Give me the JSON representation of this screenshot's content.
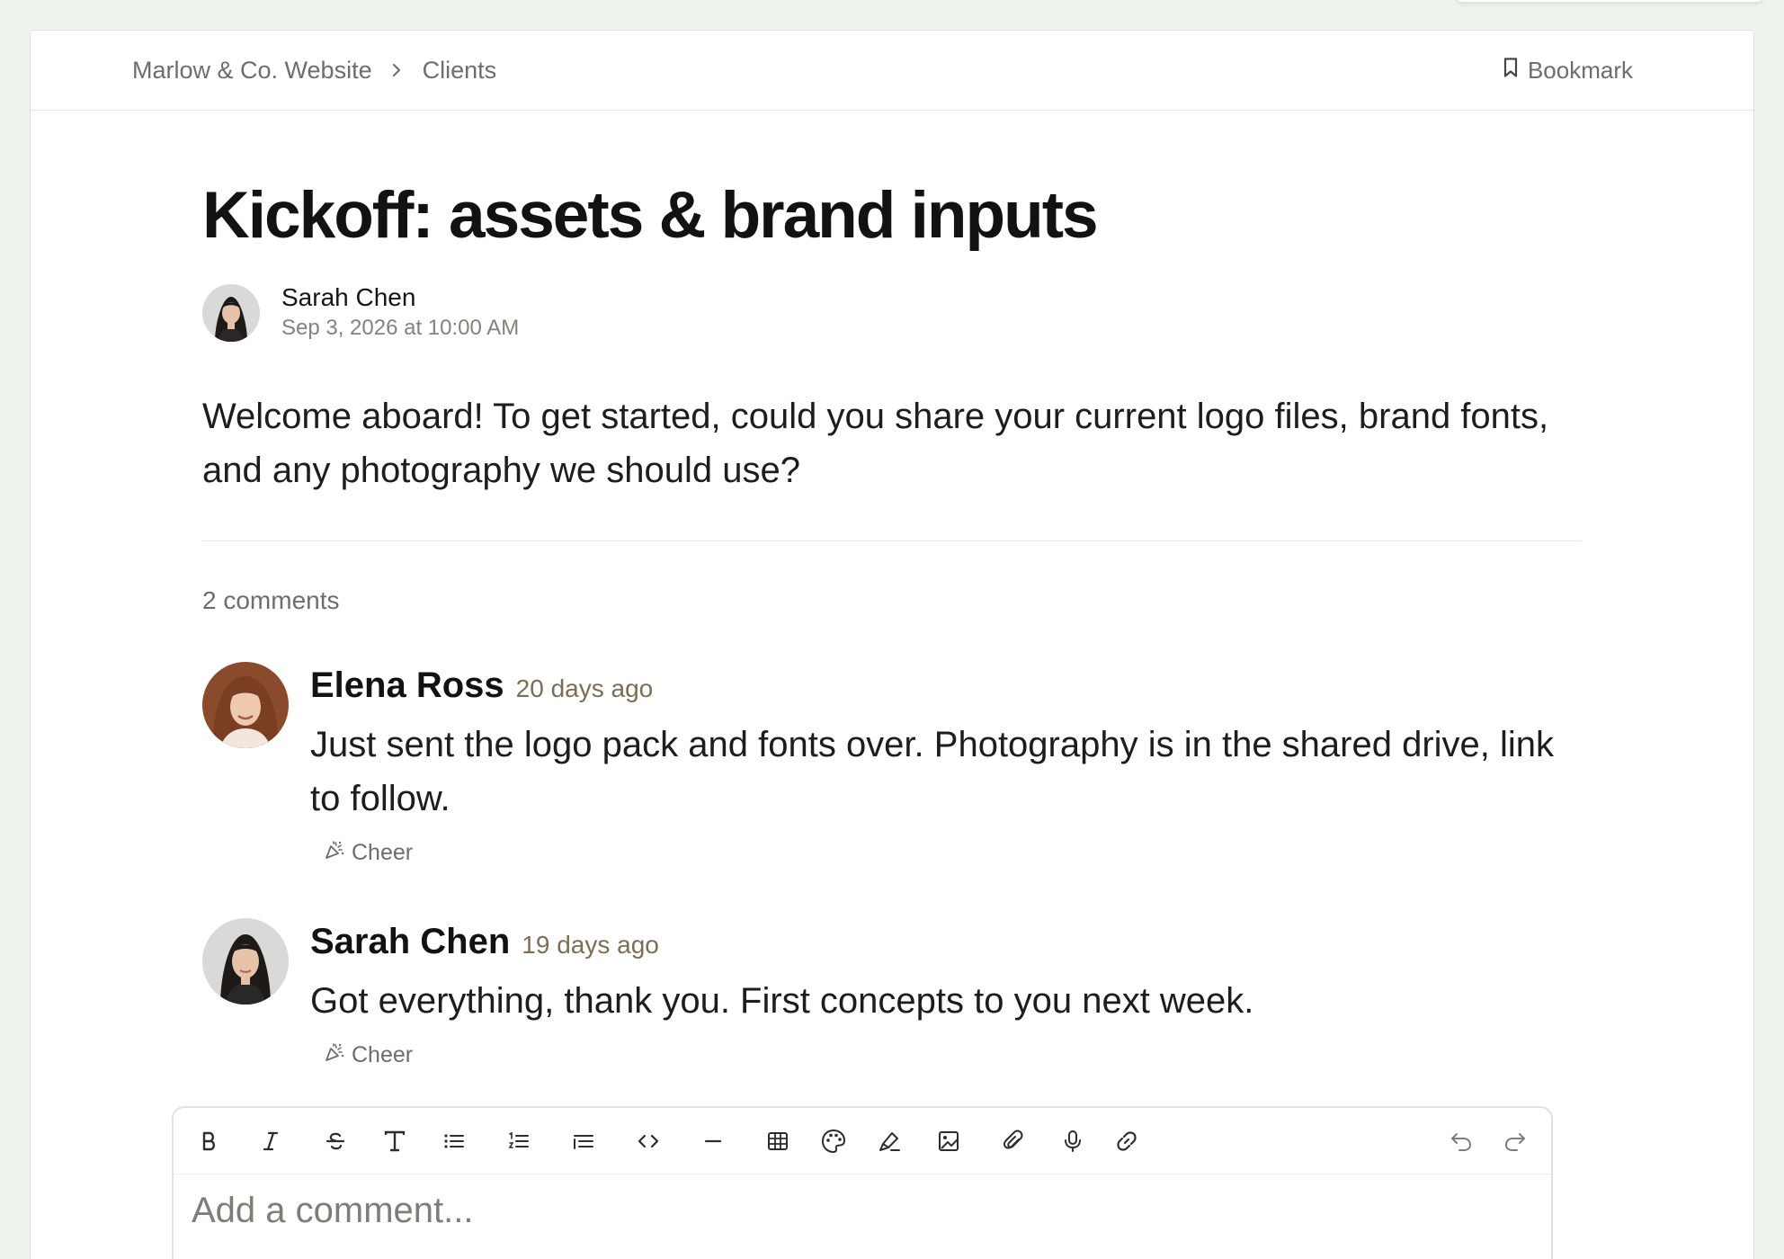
{
  "header": {
    "breadcrumb": [
      "Marlow & Co. Website",
      "Clients"
    ],
    "bookmark_label": "Bookmark"
  },
  "post": {
    "title": "Kickoff: assets & brand inputs",
    "author": "Sarah Chen",
    "date": "Sep 3, 2026 at 10:00 AM",
    "body": "Welcome aboard! To get started, could you share your current logo files, brand fonts, and any photography we should use?"
  },
  "comments_count_label": "2 comments",
  "comments": [
    {
      "author": "Elena Ross",
      "time": "20 days ago",
      "text": "Just sent the logo pack and fonts over. Photography is in the shared drive, link to follow.",
      "reaction_label": "Cheer"
    },
    {
      "author": "Sarah Chen",
      "time": "19 days ago",
      "text": "Got everything, thank you. First concepts to you next week.",
      "reaction_label": "Cheer"
    }
  ],
  "editor": {
    "placeholder": "Add a comment...",
    "toolbar": [
      "bold-icon",
      "italic-icon",
      "strikethrough-icon",
      "heading-icon",
      "bullet-list-icon",
      "numbered-list-icon",
      "indent-list-icon",
      "code-icon",
      "horizontal-rule-icon",
      "table-icon",
      "palette-icon",
      "highlight-icon",
      "image-icon",
      "attachment-icon",
      "microphone-icon",
      "link-icon",
      "undo-icon",
      "redo-icon"
    ]
  },
  "colors": {
    "background": "#eef3ee",
    "muted_text": "#6b6f68",
    "timestamp": "#7c6d55",
    "heading": "#111311"
  }
}
